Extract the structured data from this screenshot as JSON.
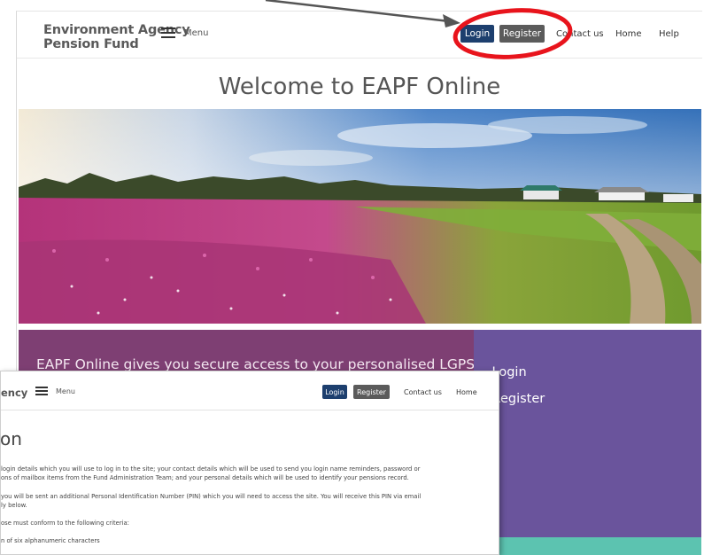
{
  "back_window": {
    "brand": {
      "line1": "Environment Agency",
      "line2": "Pension Fund"
    },
    "menu_label": "Menu",
    "nav": {
      "login": "Login",
      "register": "Register",
      "contact": "Contact us",
      "home": "Home",
      "help": "Help"
    },
    "welcome_heading": "Welcome to EAPF Online",
    "promo_text": "EAPF Online gives you secure access to your personalised LGPS",
    "side_links": {
      "login": "Login",
      "register": "Register"
    }
  },
  "front_window": {
    "brand_fragment": "ency",
    "menu_label": "Menu",
    "nav": {
      "login": "Login",
      "register": "Register",
      "contact": "Contact us",
      "home": "Home"
    },
    "page_title_fragment": "on",
    "paragraphs": [
      "login details which you will use to log in to the site; your contact details which will be used to send you login name reminders, password or",
      "ons of mailbox items from the Fund Administration Team; and your personal details which will be used to identify your pensions record.",
      "you will be sent an additional Personal Identification Number (PIN) which you will need to access the site. You will receive this PIN via email",
      "ly below.",
      "ose must conform to the following criteria:",
      "n of six alphanumeric characters"
    ]
  },
  "colors": {
    "login_button": "#1d3f6e",
    "register_button": "#5b5b5b",
    "promo_purple": "#7e3f73",
    "side_violet": "#6a549c",
    "teal_strip": "#5cc3b0",
    "annotation_red": "#e8141c"
  }
}
